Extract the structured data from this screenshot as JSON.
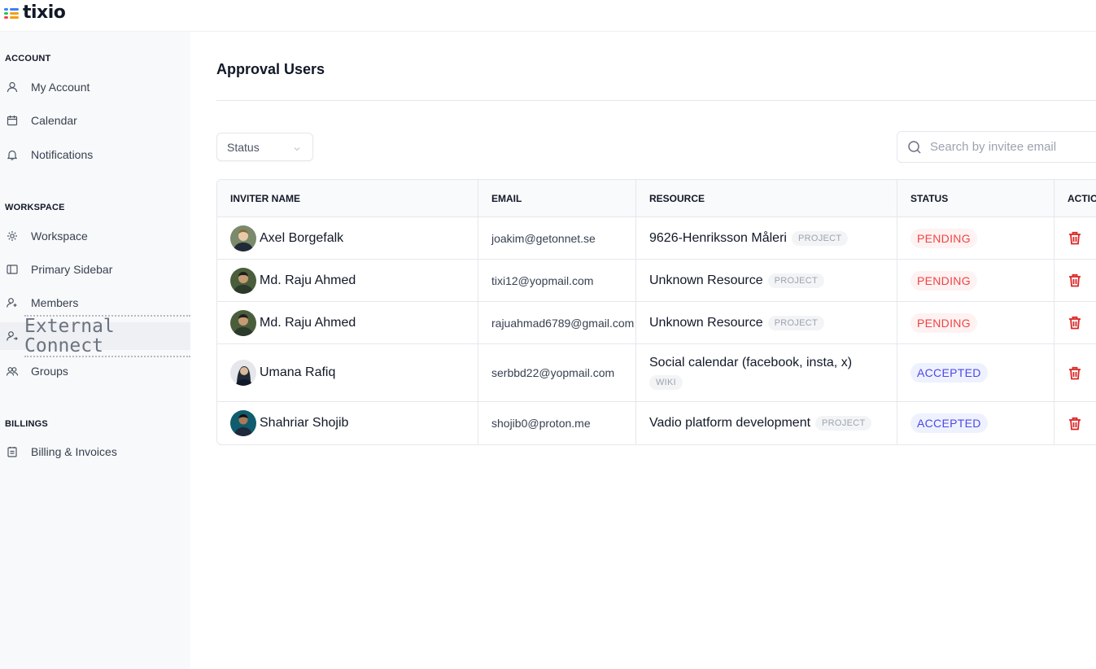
{
  "app": {
    "name": "tixio",
    "logo_colors": [
      "#3b82f6",
      "#22c55e",
      "#f59e0b",
      "#ef4444"
    ]
  },
  "sidebar": {
    "sections": [
      {
        "title": "ACCOUNT",
        "items": [
          {
            "label": "My Account",
            "icon": "user-icon"
          },
          {
            "label": "Calendar",
            "icon": "calendar-icon"
          },
          {
            "label": "Notifications",
            "icon": "bell-icon"
          }
        ]
      },
      {
        "title": "WORKSPACE",
        "items": [
          {
            "label": "Workspace",
            "icon": "gear-icon"
          },
          {
            "label": "Primary Sidebar",
            "icon": "sidebar-icon"
          },
          {
            "label": "Members",
            "icon": "user-plus-icon"
          },
          {
            "label": "External Connect",
            "icon": "user-link-icon",
            "active": true
          },
          {
            "label": "Groups",
            "icon": "users-icon"
          }
        ]
      },
      {
        "title": "BILLINGS",
        "items": [
          {
            "label": "Billing & Invoices",
            "icon": "invoice-icon"
          }
        ]
      }
    ]
  },
  "main": {
    "title": "Approval Users",
    "filter": {
      "label": "Status"
    },
    "search": {
      "placeholder": "Search by invitee email",
      "value": ""
    },
    "table": {
      "columns": [
        "INVITER NAME",
        "EMAIL",
        "RESOURCE",
        "STATUS",
        "ACTION"
      ],
      "rows": [
        {
          "name": "Axel Borgefalk",
          "email": "joakim@getonnet.se",
          "resource": "9626-Henriksson Måleri",
          "resource_type": "PROJECT",
          "status": "PENDING",
          "avatar_color": "#6b7f5a"
        },
        {
          "name": "Md. Raju Ahmed",
          "email": "tixi12@yopmail.com",
          "resource": "Unknown Resource",
          "resource_type": "PROJECT",
          "status": "PENDING",
          "avatar_color": "#4b5e3c"
        },
        {
          "name": "Md. Raju Ahmed",
          "email": "rajuahmad6789@gmail.com",
          "resource": "Unknown Resource",
          "resource_type": "PROJECT",
          "status": "PENDING",
          "avatar_color": "#4b5e3c"
        },
        {
          "name": "Umana Rafiq",
          "email": "serbbd22@yopmail.com",
          "resource": "Social calendar (facebook, insta, x)",
          "resource_type": "WIKI",
          "status": "ACCEPTED",
          "avatar_color": "#d1d5db"
        },
        {
          "name": "Shahriar Shojib",
          "email": "shojib0@proton.me",
          "resource": "Vadio platform development",
          "resource_type": "PROJECT",
          "status": "ACCEPTED",
          "avatar_color": "#0f5c6e"
        }
      ]
    }
  }
}
